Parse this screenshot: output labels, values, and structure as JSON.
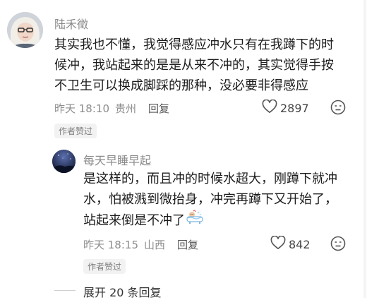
{
  "comments": [
    {
      "username": "陆禾徵",
      "lines": [
        "其实我也不懂，我觉得感应冲水只有在我蹲下的时",
        "候冲，我站起来的是是从来不冲的，其实觉得手按",
        "不卫生可以换成脚踩的那种，没必要非得感应"
      ],
      "time": "昨天 18:10",
      "location": "贵州",
      "reply_label": "回复",
      "like_count": "2897",
      "badge": "作者赞过"
    },
    {
      "username": "每天早睡早起",
      "lines": [
        "是这样的，而且冲的时候水超大，刚蹲下就冲",
        "水，怕被溅到微抬身，冲完再蹲下又开始了，",
        "站起来倒是不冲了"
      ],
      "time": "昨天 18:15",
      "location": "山西",
      "reply_label": "回复",
      "like_count": "842",
      "badge": "作者赞过"
    }
  ],
  "expand": {
    "label": "展开 20 条回复"
  },
  "icons": {
    "like": "heart-outline-icon",
    "dislike": "unhappy-face-icon",
    "emoji": "bathing-emoji-icon"
  },
  "colors": {
    "muted": "#8c8c8c",
    "badge_bg": "#f2f2f2"
  }
}
